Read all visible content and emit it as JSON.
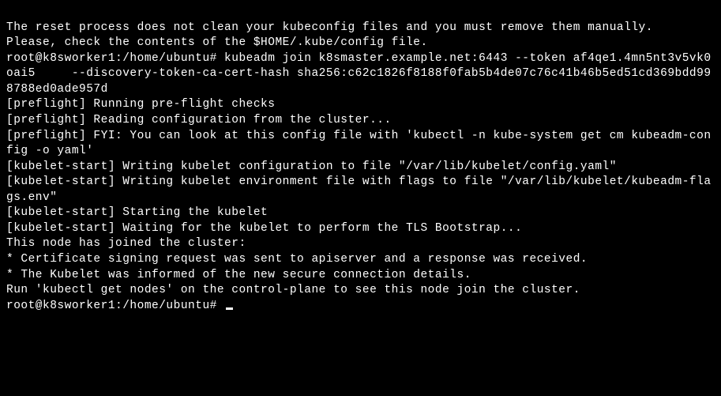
{
  "terminal": {
    "lines": [
      "The reset process does not clean your kubeconfig files and you must remove them manually.",
      "Please, check the contents of the $HOME/.kube/config file.",
      "root@k8sworker1:/home/ubuntu# kubeadm join k8smaster.example.net:6443 --token af4qe1.4mn5nt3v5vk0oai5     --discovery-token-ca-cert-hash sha256:c62c1826f8188f0fab5b4de07c76c41b46b5ed51cd369bdd998788ed0ade957d",
      "[preflight] Running pre-flight checks",
      "[preflight] Reading configuration from the cluster...",
      "[preflight] FYI: You can look at this config file with 'kubectl -n kube-system get cm kubeadm-config -o yaml'",
      "[kubelet-start] Writing kubelet configuration to file \"/var/lib/kubelet/config.yaml\"",
      "[kubelet-start] Writing kubelet environment file with flags to file \"/var/lib/kubelet/kubeadm-flags.env\"",
      "[kubelet-start] Starting the kubelet",
      "[kubelet-start] Waiting for the kubelet to perform the TLS Bootstrap...",
      "",
      "This node has joined the cluster:",
      "* Certificate signing request was sent to apiserver and a response was received.",
      "* The Kubelet was informed of the new secure connection details.",
      "",
      "Run 'kubectl get nodes' on the control-plane to see this node join the cluster.",
      "",
      "root@k8sworker1:/home/ubuntu# "
    ]
  }
}
